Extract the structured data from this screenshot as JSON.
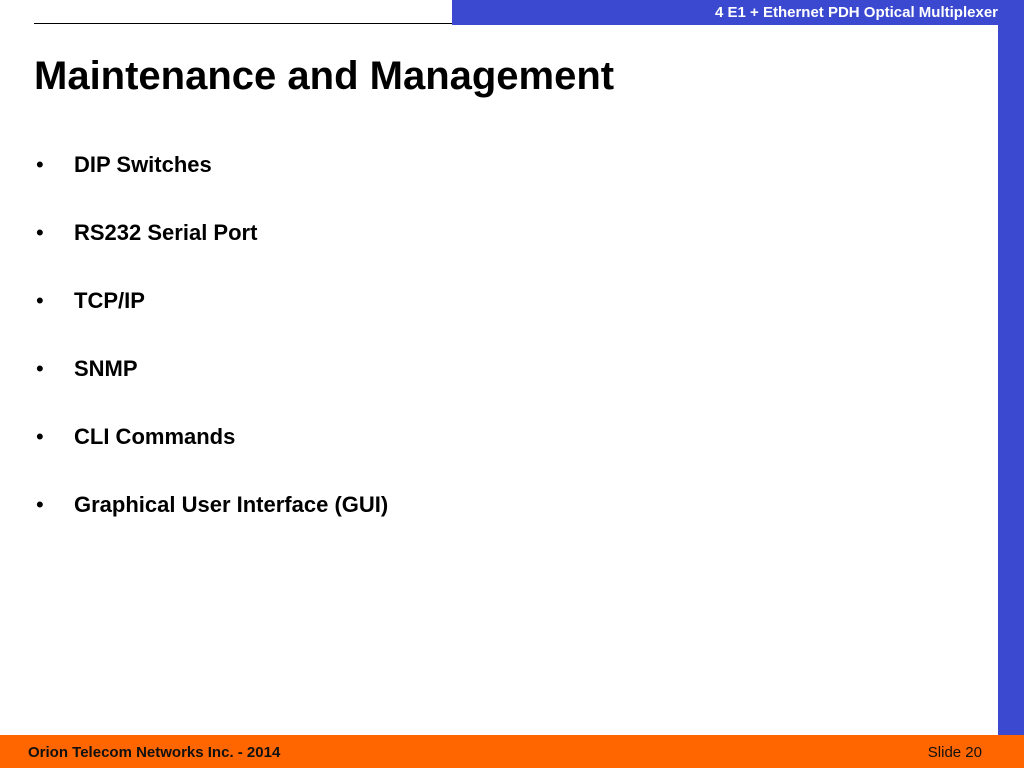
{
  "header": {
    "product_title": "4 E1 + Ethernet PDH Optical Multiplexer"
  },
  "slide": {
    "title": "Maintenance and Management",
    "bullets": [
      "DIP Switches",
      "RS232 Serial Port",
      "TCP/IP",
      "SNMP",
      "CLI Commands",
      "Graphical User Interface (GUI)"
    ],
    "bullet_glyph": "•"
  },
  "footer": {
    "company": "Orion Telecom Networks Inc. - 2014",
    "slide_number": "Slide 20"
  },
  "colors": {
    "accent_blue": "#3b49d1",
    "footer_orange": "#ff6600"
  }
}
